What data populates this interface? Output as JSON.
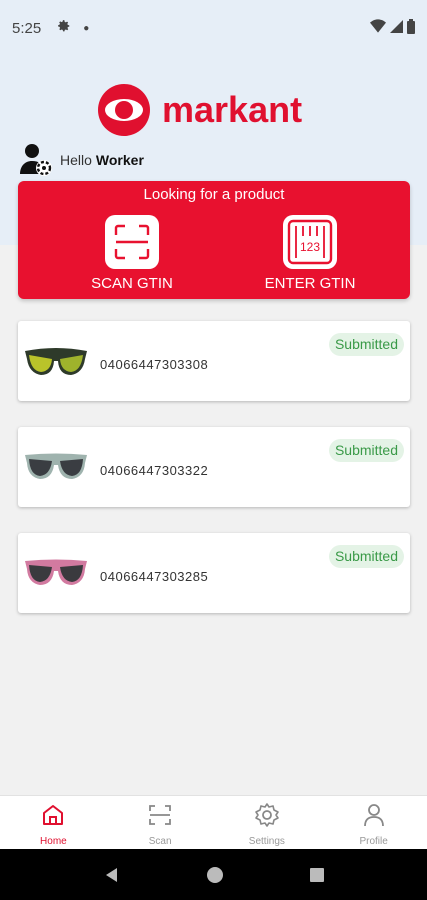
{
  "status_bar": {
    "time": "5:25",
    "icons": [
      "gear-icon",
      "notification-dot-icon",
      "wifi-icon",
      "signal-icon",
      "battery-icon"
    ]
  },
  "brand": {
    "name": "markant",
    "color": "#e0102f"
  },
  "greeting": {
    "hello": "Hello",
    "user": "Worker"
  },
  "action_card": {
    "title": "Looking for a product",
    "scan_label": "SCAN GTIN",
    "enter_label": "ENTER GTIN",
    "enter_icon_digits": "123",
    "color": "#e8112f"
  },
  "products": [
    {
      "gtin": "04066447303308",
      "status": "Submitted",
      "thumb": "mirrored-sport-sunglasses"
    },
    {
      "gtin": "04066447303322",
      "status": "Submitted",
      "thumb": "grey-frame-sunglasses"
    },
    {
      "gtin": "04066447303285",
      "status": "Submitted",
      "thumb": "pink-pattern-sunglasses"
    }
  ],
  "bottom_nav": [
    {
      "label": "Home",
      "icon": "home-icon",
      "active": true
    },
    {
      "label": "Scan",
      "icon": "scan-icon",
      "active": false
    },
    {
      "label": "Settings",
      "icon": "settings-icon",
      "active": false
    },
    {
      "label": "Profile",
      "icon": "profile-icon",
      "active": false
    }
  ],
  "colors": {
    "status_submitted_text": "#3a9a48",
    "status_submitted_bg": "#e4f3e6",
    "header_bg": "#e6eef7"
  }
}
